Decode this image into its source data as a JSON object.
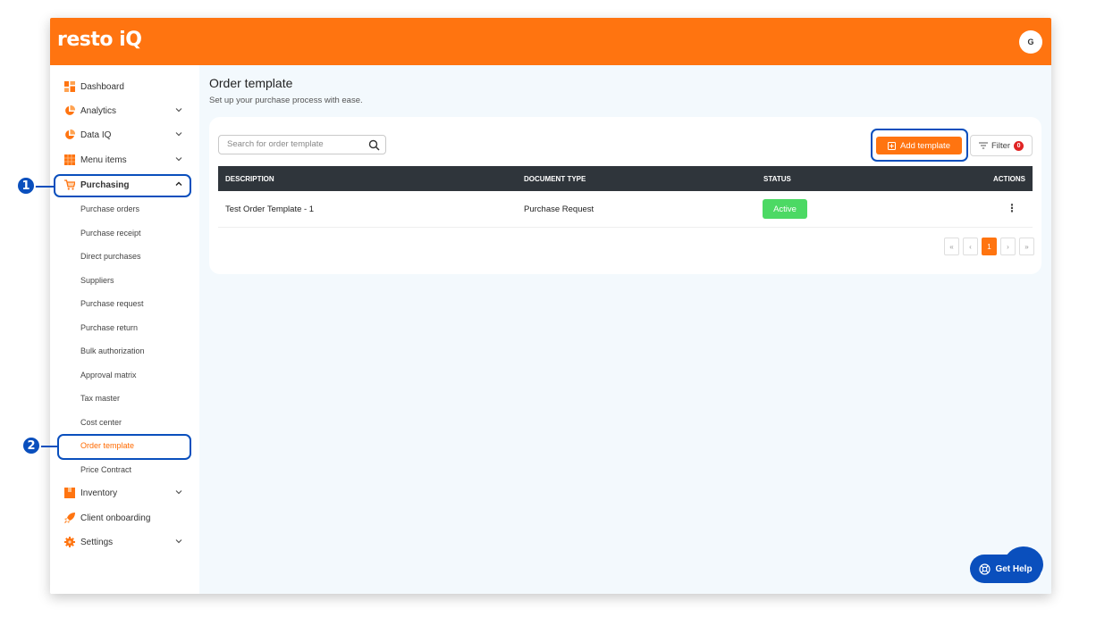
{
  "app": {
    "logo": "resto iQ",
    "avatar_initial": "G"
  },
  "colors": {
    "brand": "#ff7410",
    "highlight": "#0a4fbd",
    "status_active": "#4cd964",
    "table_header": "#2f353b"
  },
  "sidebar": {
    "items": [
      {
        "label": "Dashboard",
        "icon": "dashboard-icon",
        "has_chevron": false
      },
      {
        "label": "Analytics",
        "icon": "pie-chart-icon",
        "has_chevron": true
      },
      {
        "label": "Data IQ",
        "icon": "pie-chart-icon",
        "has_chevron": true
      },
      {
        "label": "Menu items",
        "icon": "grid-icon",
        "has_chevron": true
      },
      {
        "label": "Purchasing",
        "icon": "cart-icon",
        "has_chevron": true,
        "expanded": true
      },
      {
        "label": "Inventory",
        "icon": "box-icon",
        "has_chevron": true
      },
      {
        "label": "Client onboarding",
        "icon": "rocket-icon",
        "has_chevron": false
      },
      {
        "label": "Settings",
        "icon": "gear-icon",
        "has_chevron": true
      }
    ],
    "purchasing_sub": [
      "Purchase orders",
      "Purchase receipt",
      "Direct purchases",
      "Suppliers",
      "Purchase request",
      "Purchase return",
      "Bulk authorization",
      "Approval matrix",
      "Tax master",
      "Cost center",
      "Order template",
      "Price Contract"
    ],
    "active_sub": "Order template"
  },
  "main": {
    "title": "Order template",
    "subtitle": "Set up your purchase process with ease.",
    "search": {
      "placeholder": "Search for order template",
      "value": ""
    },
    "add_button": "Add template",
    "filter_button": "Filter",
    "filter_count": "0",
    "table": {
      "columns": [
        "DESCRIPTION",
        "DOCUMENT TYPE",
        "STATUS",
        "ACTIONS"
      ],
      "rows": [
        {
          "description": "Test Order Template - 1",
          "document_type": "Purchase Request",
          "status": "Active"
        }
      ]
    },
    "pagination": {
      "first": "«",
      "prev": "‹",
      "current": "1",
      "next": "›",
      "last": "»"
    }
  },
  "help_button": "Get Help",
  "callouts": [
    "1",
    "2"
  ]
}
